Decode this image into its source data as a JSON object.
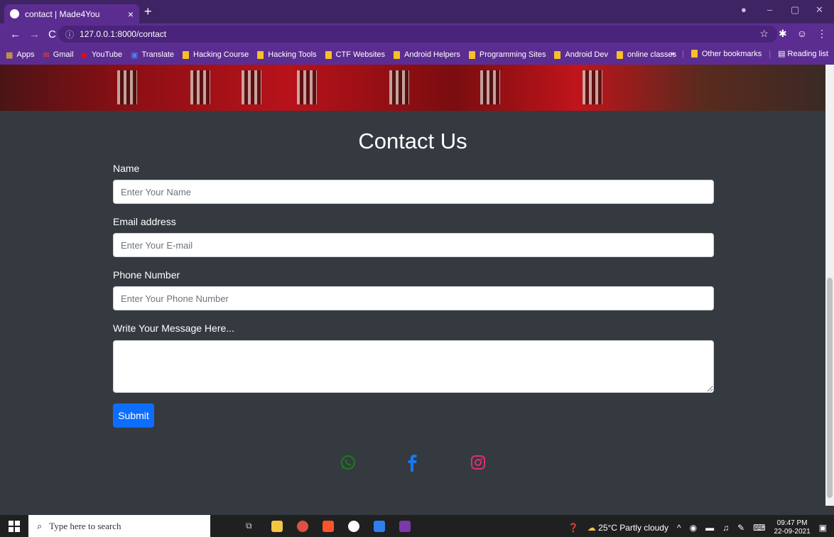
{
  "browser": {
    "tab_title": "contact | Made4You",
    "tab_close": "×",
    "new_tab": "+",
    "url": "127.0.0.1:8000/contact",
    "bookmarks": [
      "Apps",
      "Gmail",
      "YouTube",
      "Translate",
      "Hacking Course",
      "Hacking Tools",
      "CTF Websites",
      "Android Helpers",
      "Programming Sites",
      "Android Dev",
      "online classes"
    ],
    "overflow": "»",
    "other_bookmarks": "Other bookmarks",
    "reading_list": "Reading list"
  },
  "page": {
    "title": "Contact Us",
    "name_label": "Name",
    "name_placeholder": "Enter Your Name",
    "email_label": "Email address",
    "email_placeholder": "Enter Your E-mail",
    "phone_label": "Phone Number",
    "phone_placeholder": "Enter Your Phone Number",
    "message_label": "Write Your Message Here...",
    "submit_label": "Submit",
    "social": [
      {
        "icon": "whatsapp-icon",
        "color": "#1d7a1d"
      },
      {
        "icon": "facebook-icon",
        "color": "#1877f2"
      },
      {
        "icon": "instagram-icon",
        "color": "#e1306c"
      }
    ]
  },
  "taskbar": {
    "search_placeholder": "Type here to search",
    "weather": "25°C  Partly cloudy",
    "time": "09:47 PM",
    "date": "22-09-2021"
  }
}
